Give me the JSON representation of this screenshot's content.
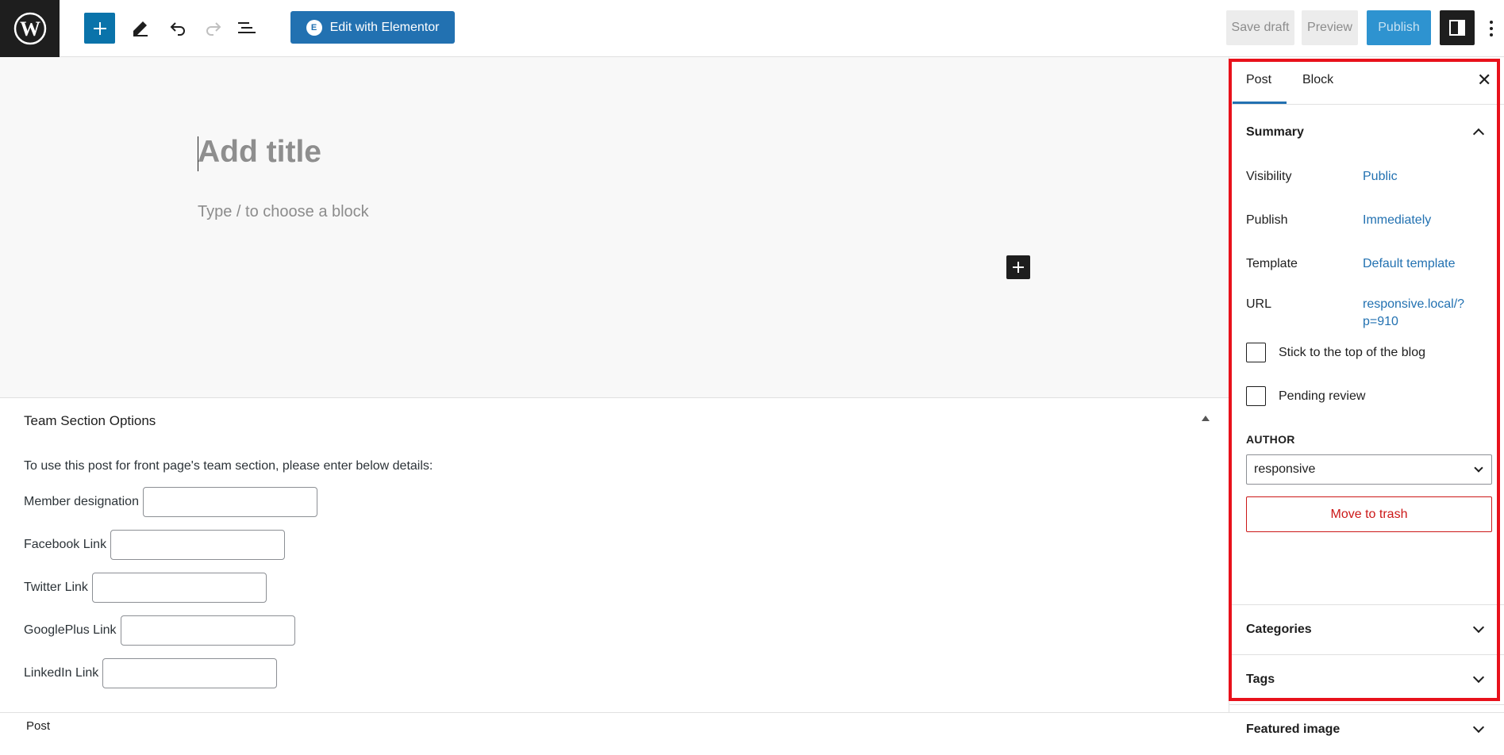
{
  "toolbar": {
    "edit_with_elementor": "Edit with Elementor",
    "save_draft": "Save draft",
    "preview": "Preview",
    "publish": "Publish"
  },
  "editor": {
    "title_placeholder": "Add title",
    "block_hint": "Type / to choose a block"
  },
  "metabox": {
    "title": "Team Section Options",
    "description": "To use this post for front page's team section, please enter below details:",
    "fields": [
      {
        "label": "Member designation",
        "value": ""
      },
      {
        "label": "Facebook Link",
        "value": ""
      },
      {
        "label": "Twitter Link",
        "value": ""
      },
      {
        "label": "GooglePlus Link",
        "value": ""
      },
      {
        "label": "LinkedIn Link",
        "value": ""
      }
    ]
  },
  "footer": {
    "breadcrumb": "Post"
  },
  "sidebar": {
    "tabs": [
      "Post",
      "Block"
    ],
    "active_tab": "Post",
    "summary": {
      "title": "Summary",
      "rows": [
        {
          "label": "Visibility",
          "value": "Public"
        },
        {
          "label": "Publish",
          "value": "Immediately"
        },
        {
          "label": "Template",
          "value": "Default template"
        },
        {
          "label": "URL",
          "value": "responsive.local/?p=910"
        }
      ],
      "url_line1": "responsive.local/?",
      "url_line2": "p=910",
      "sticky_label": "Stick to the top of the blog",
      "pending_label": "Pending review",
      "author_label": "AUTHOR",
      "author_value": "responsive",
      "trash_label": "Move to trash"
    },
    "sections": [
      "Categories",
      "Tags",
      "Featured image"
    ]
  },
  "colors": {
    "accent": "#2271b1",
    "highlight": "#e8111b",
    "danger": "#cc1818"
  }
}
